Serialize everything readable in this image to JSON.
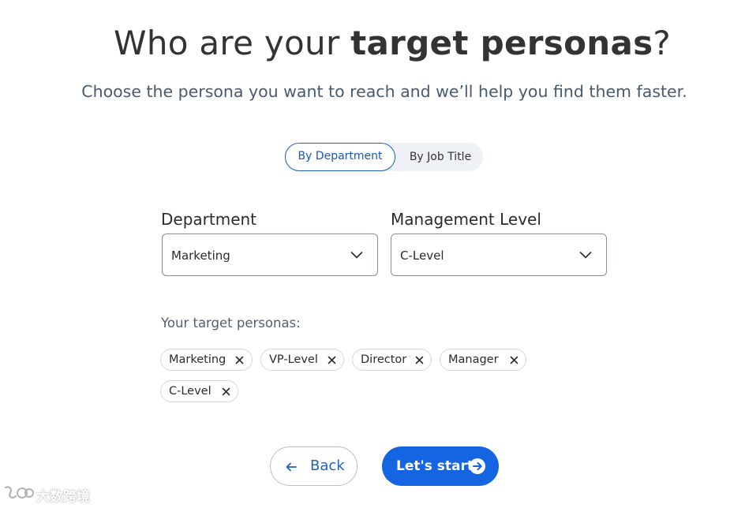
{
  "header": {
    "title_prefix": "Who are your ",
    "title_bold": "target personas",
    "title_suffix": "?",
    "subtitle": "Choose the persona you want to reach and we’ll help you find them faster."
  },
  "toggle": {
    "options": [
      "By Department",
      "By Job Title"
    ],
    "selected": "By Department"
  },
  "form": {
    "department": {
      "label": "Department",
      "value": "Marketing"
    },
    "management_level": {
      "label": "Management Level",
      "value": "C-Level"
    }
  },
  "personas": {
    "label": "Your target personas:",
    "chips": [
      "Marketing",
      "VP-Level",
      "Director",
      "Manager",
      "C-Level"
    ]
  },
  "actions": {
    "back_label": "Back",
    "start_label": "Let's start"
  },
  "watermark": {
    "text": "大数跨境"
  },
  "colors": {
    "accent": "#1565e3",
    "accent_text": "#1a56b8",
    "title": "#333333",
    "subtitle": "#4a5a6c"
  },
  "icons": {
    "dropdown": "chevron-down-icon",
    "chip_remove": "close-icon",
    "back": "arrow-left-icon",
    "start": "arrow-right-circle-icon"
  }
}
